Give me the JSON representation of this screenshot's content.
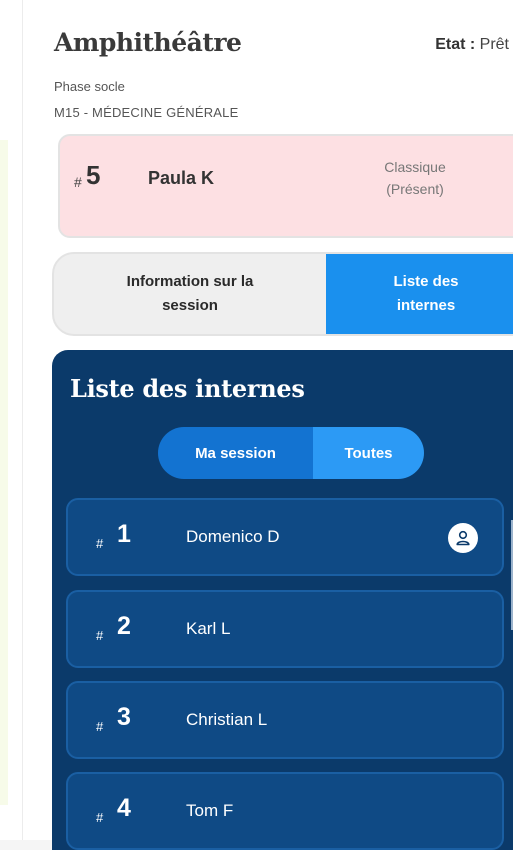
{
  "header": {
    "title": "Amphithéâtre",
    "etat_label": "Etat :",
    "etat_value": "Prêt",
    "phase": "Phase socle",
    "specialty": "M15 - MÉDECINE GÉNÉRALE"
  },
  "current_card": {
    "hash": "#",
    "number": "5",
    "name": "Paula K",
    "type_line1": "Classique",
    "type_line2": "(Présent)"
  },
  "tabs": {
    "info_label": "Information sur la session",
    "list_label": "Liste des internes"
  },
  "panel": {
    "title": "Liste des internes",
    "filter_mine": "Ma session",
    "filter_all": "Toutes",
    "rows": [
      {
        "hash": "#",
        "number": "1",
        "name": "Domenico D",
        "icon": "user-icon"
      },
      {
        "hash": "#",
        "number": "2",
        "name": "Karl L"
      },
      {
        "hash": "#",
        "number": "3",
        "name": "Christian L"
      },
      {
        "hash": "#",
        "number": "4",
        "name": "Tom F"
      }
    ]
  },
  "colors": {
    "card_bg": "#fde0e3",
    "tab_active": "#1a90ee",
    "panel_bg": "#0b3a6a",
    "row_bg": "#0f4a85",
    "seg_mine": "#1373d1",
    "seg_all": "#2c9af5"
  }
}
